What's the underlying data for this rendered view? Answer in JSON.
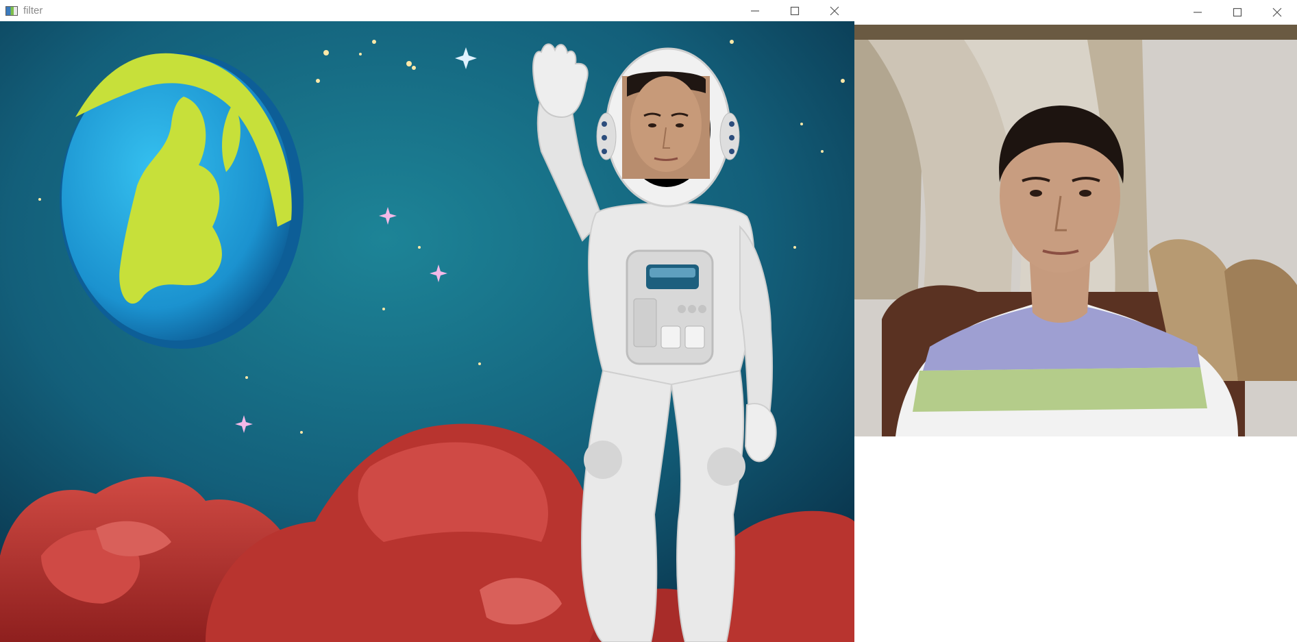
{
  "filter_window": {
    "title": "filter",
    "icon": "app-window-icon",
    "controls": [
      "minimize-icon",
      "maximize-icon",
      "close-icon"
    ]
  },
  "camera_window": {
    "title": "",
    "controls": [
      "minimize-icon",
      "maximize-icon",
      "close-icon"
    ]
  },
  "colors": {
    "space_top": "#1c7f95",
    "space_bottom": "#0a2f45",
    "planet_ocean": "#2aa7de",
    "planet_land": "#c7e03a",
    "rocks": "#b8342f",
    "suit": "#e9e9e9",
    "wall": "#d3cfca",
    "curtain": "#c9c0b2",
    "shirt_purple": "#9e9fd2",
    "shirt_green": "#b4cc8a"
  }
}
